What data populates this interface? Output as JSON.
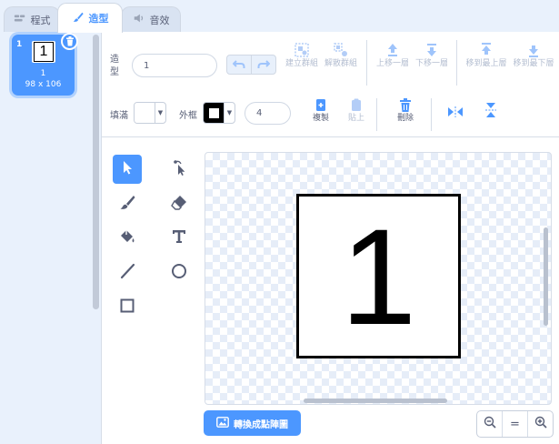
{
  "tabs": [
    {
      "label": "程式",
      "icon": "code-icon"
    },
    {
      "label": "造型",
      "icon": "brush-icon"
    },
    {
      "label": "音效",
      "icon": "speaker-icon"
    }
  ],
  "costume_list": {
    "items": [
      {
        "number": "1",
        "thumbnail_text": "1",
        "name": "1",
        "size": "98 x 106"
      }
    ]
  },
  "toolbar": {
    "costume_label": "造型",
    "costume_name": "1",
    "group_label": "建立群組",
    "ungroup_label": "解散群組",
    "forward_label": "上移一層",
    "backward_label": "下移一層",
    "front_label": "移到最上層",
    "back_label": "移到最下層",
    "fill_label": "填滿",
    "outline_label": "外框",
    "outline_width": "4",
    "copy_label": "複製",
    "paste_label": "貼上",
    "delete_label": "刪除",
    "fill_color": "#ffffff",
    "outline_color": "#000000"
  },
  "canvas": {
    "costume_text": "1"
  },
  "footer": {
    "convert_label": "轉換成點陣圖",
    "zoom_reset_label": "="
  },
  "colors": {
    "accent": "#4c97ff",
    "text": "#575e75"
  }
}
